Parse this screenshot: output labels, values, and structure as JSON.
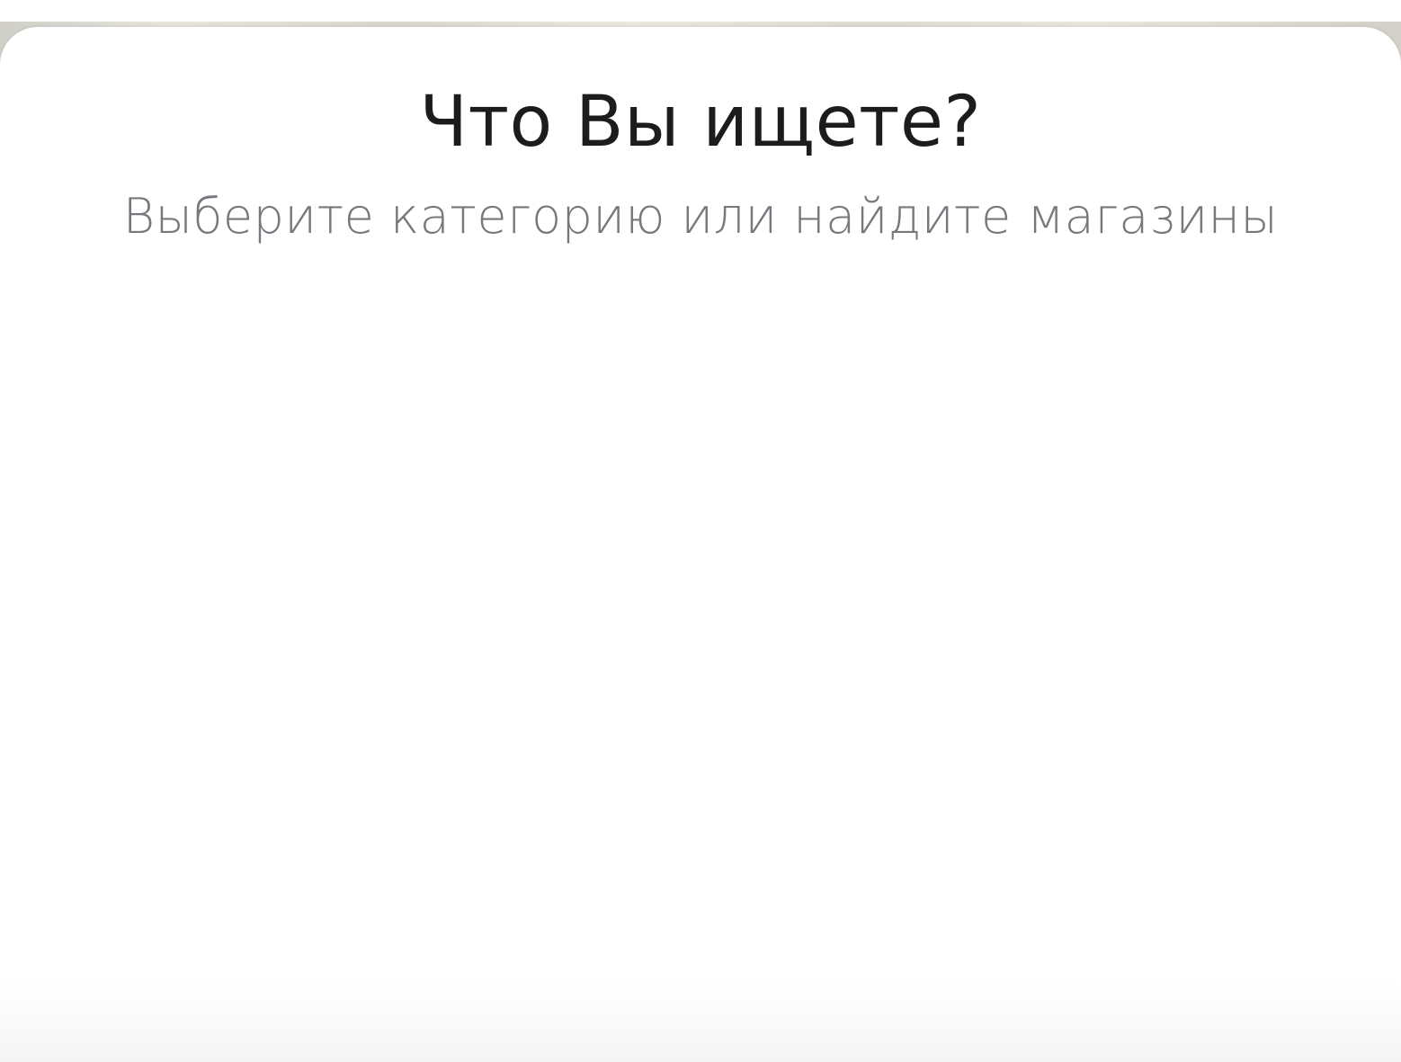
{
  "modal": {
    "title": "Что Вы ищете?",
    "subtitle": "Выберите категорию или найдите магазины"
  },
  "colors": {
    "title": "#1c1c1e",
    "subtitle": "#77777d",
    "sheet_background": "#ffffff"
  }
}
